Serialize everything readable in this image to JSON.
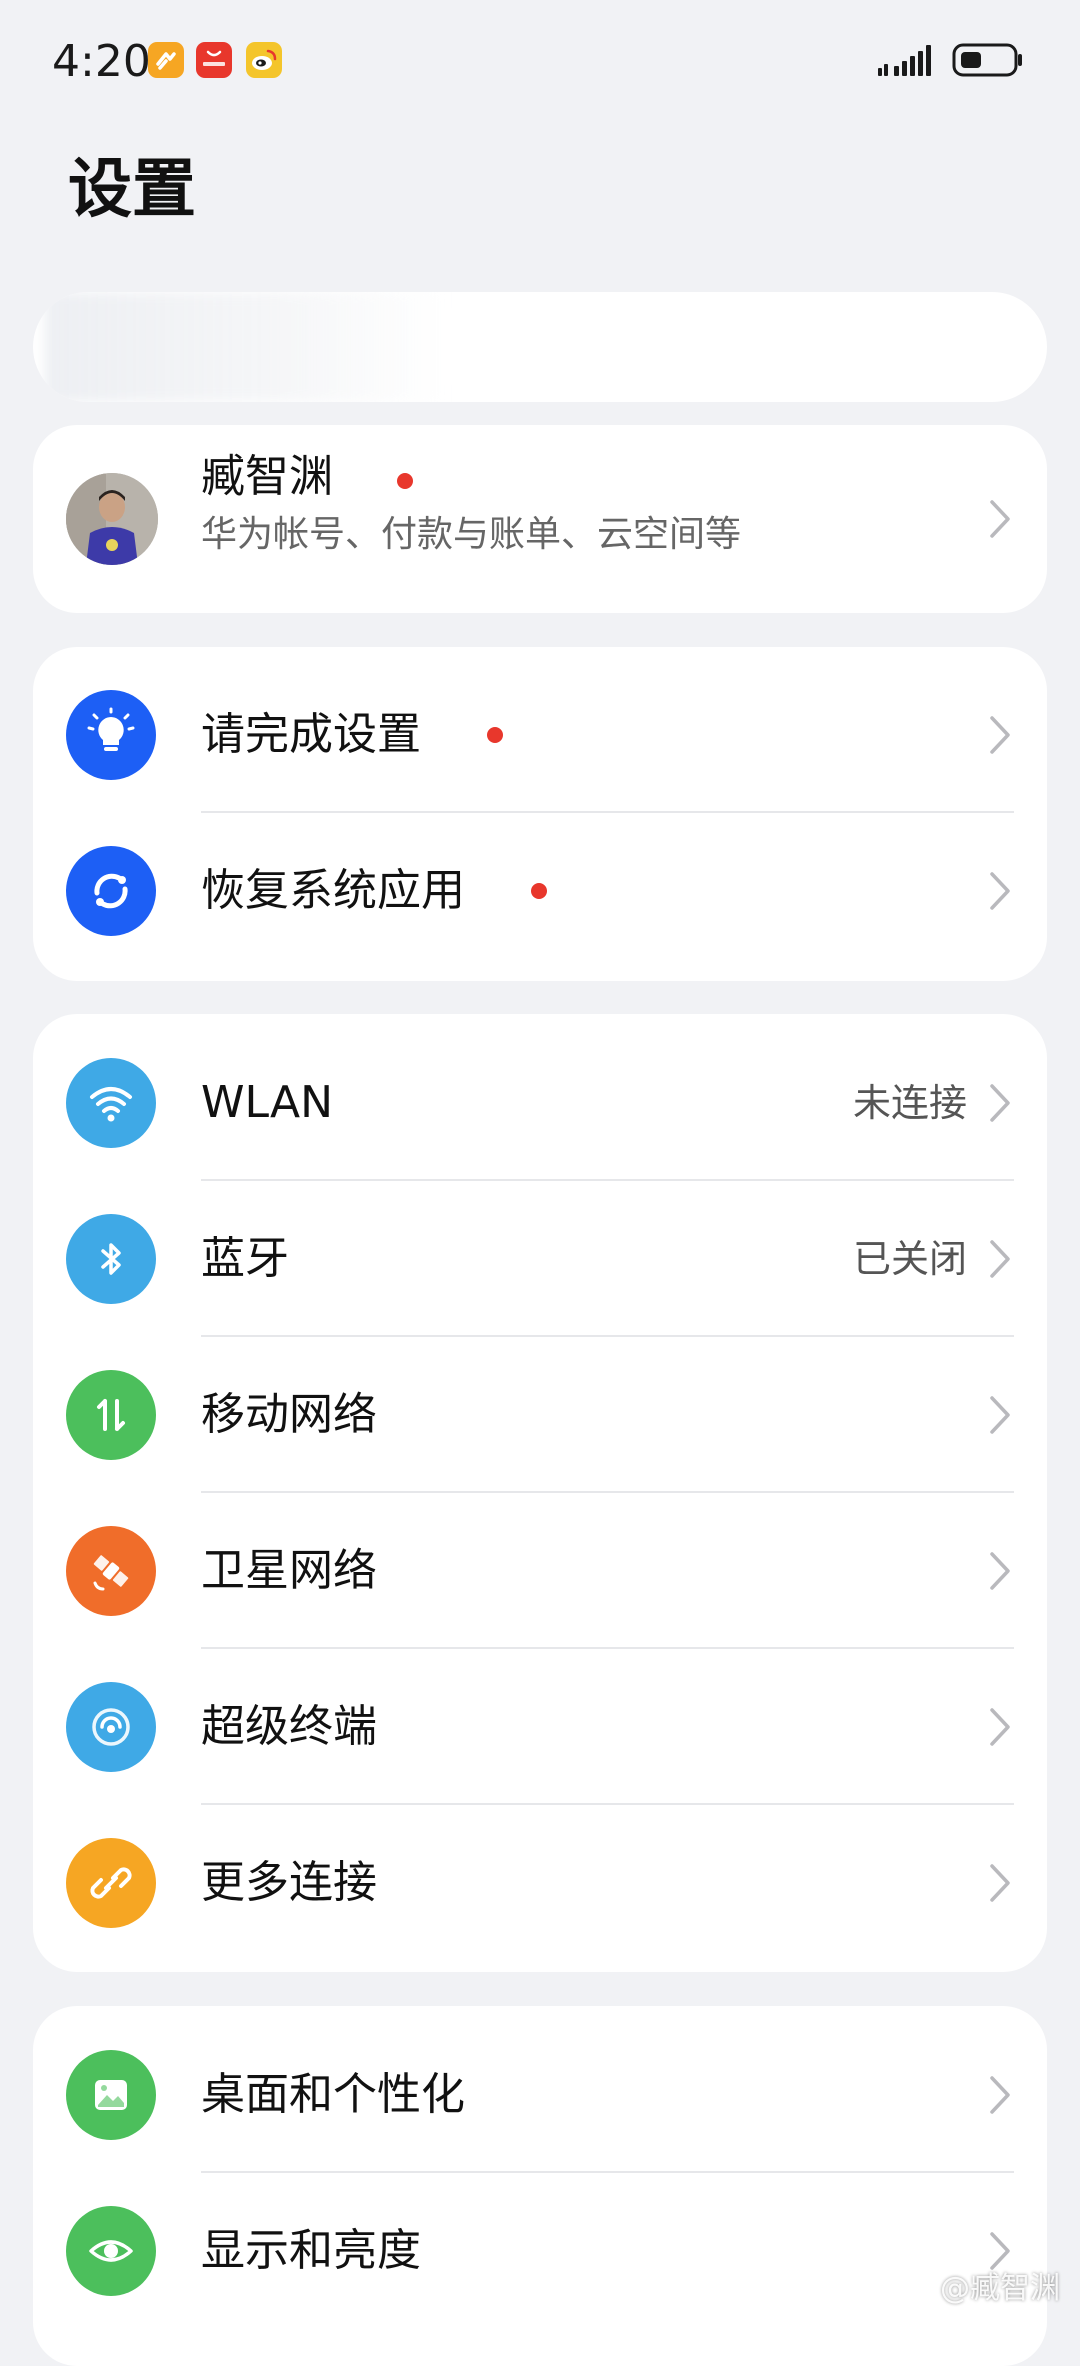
{
  "status_bar": {
    "time": "4:20",
    "app_icons": [
      "huawei-health-icon",
      "huawei-store-icon",
      "weibo-icon"
    ],
    "app_icon_colors": [
      "#f6a623",
      "#e8372c",
      "#f4c52b"
    ],
    "signal_icon": "signal-strength-icon",
    "battery_icon": "battery-icon"
  },
  "page": {
    "title": "设置"
  },
  "account": {
    "name": "臧智渊",
    "subtitle": "华为帐号、付款与账单、云空间等",
    "has_badge": true
  },
  "setup_group": {
    "items": [
      {
        "label": "请完成设置",
        "icon": "lightbulb-icon",
        "icon_color": "#1d5ff5",
        "has_badge": true
      },
      {
        "label": "恢复系统应用",
        "icon": "restore-icon",
        "icon_color": "#1d5ff5",
        "has_badge": true
      }
    ]
  },
  "connectivity_group": {
    "items": [
      {
        "label": "WLAN",
        "value": "未连接",
        "icon": "wifi-icon",
        "icon_color": "#3fa9e6"
      },
      {
        "label": "蓝牙",
        "value": "已关闭",
        "icon": "bluetooth-icon",
        "icon_color": "#3fa9e6"
      },
      {
        "label": "移动网络",
        "value": "",
        "icon": "mobile-data-icon",
        "icon_color": "#4cbf5c"
      },
      {
        "label": "卫星网络",
        "value": "",
        "icon": "satellite-icon",
        "icon_color": "#f06d2a"
      },
      {
        "label": "超级终端",
        "value": "",
        "icon": "super-device-icon",
        "icon_color": "#3fa9e6"
      },
      {
        "label": "更多连接",
        "value": "",
        "icon": "link-icon",
        "icon_color": "#f6a623"
      }
    ]
  },
  "display_group": {
    "items": [
      {
        "label": "桌面和个性化",
        "icon": "wallpaper-icon",
        "icon_color": "#4cbf5c"
      },
      {
        "label": "显示和亮度",
        "icon": "eye-icon",
        "icon_color": "#4cbf5c"
      }
    ]
  },
  "watermark": {
    "text": "@臧智渊",
    "icon": "weibo-logo-icon"
  }
}
